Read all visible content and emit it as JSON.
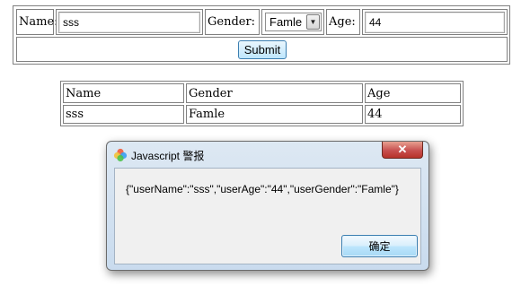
{
  "form": {
    "name_label": "Name:",
    "name_value": "sss",
    "gender_label": "Gender:",
    "gender_selected": "Famle",
    "age_label": "Age:",
    "age_value": "44",
    "submit_label": "Submit"
  },
  "result_table": {
    "headers": [
      "Name",
      "Gender",
      "Age"
    ],
    "rows": [
      [
        "sss",
        "Famle",
        "44"
      ]
    ]
  },
  "alert": {
    "title": "Javascript 警报",
    "close_glyph": "✕",
    "message": "{\"userName\":\"sss\",\"userAge\":\"44\",\"userGender\":\"Famle\"}",
    "ok_label": "确定"
  },
  "colors": {
    "border": "#808080",
    "button_border": "#3c7fb1",
    "close_red": "#c75050",
    "dialog_frame": "#c9dbee"
  },
  "icons": {
    "dropdown": "chevron-down-icon",
    "browser_logo": "browser-logo-icon",
    "close": "close-icon"
  }
}
